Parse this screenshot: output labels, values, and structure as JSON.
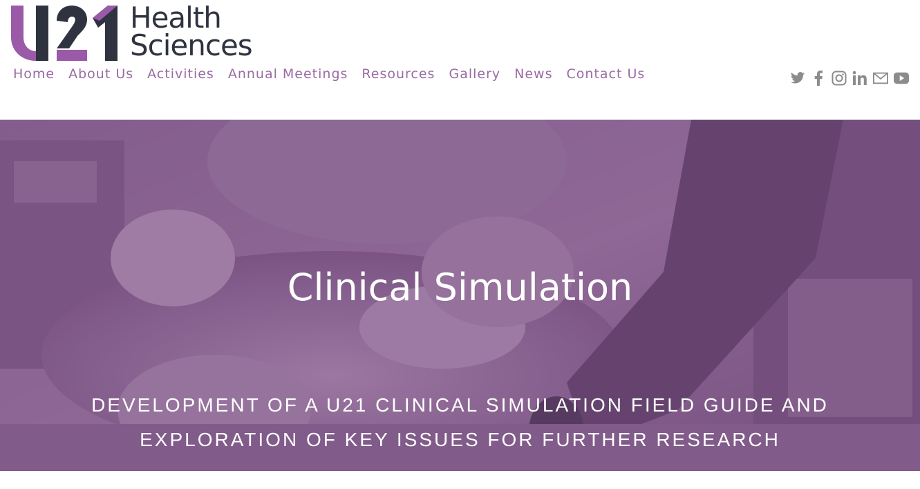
{
  "logo": {
    "mark": "U21",
    "line1": "Health",
    "line2": "Sciences",
    "colors": {
      "purple": "#9a5aa8",
      "dark": "#2f3340"
    }
  },
  "nav": {
    "items": [
      {
        "label": "Home"
      },
      {
        "label": "About Us"
      },
      {
        "label": "Activities"
      },
      {
        "label": "Annual Meetings"
      },
      {
        "label": "Resources"
      },
      {
        "label": "Gallery"
      },
      {
        "label": "News"
      },
      {
        "label": "Contact Us"
      }
    ],
    "color": "#9a6aa3"
  },
  "social": {
    "icons": [
      "twitter-icon",
      "facebook-icon",
      "instagram-icon",
      "linkedin-icon",
      "email-icon",
      "youtube-icon"
    ],
    "color": "#8c8c8c"
  },
  "hero": {
    "title": "Clinical Simulation",
    "subtitle": "Development of a U21 Clinical Simulation Field Guide and Exploration of Key Issues for Further Research",
    "overlay_color": "#7a4e84"
  }
}
